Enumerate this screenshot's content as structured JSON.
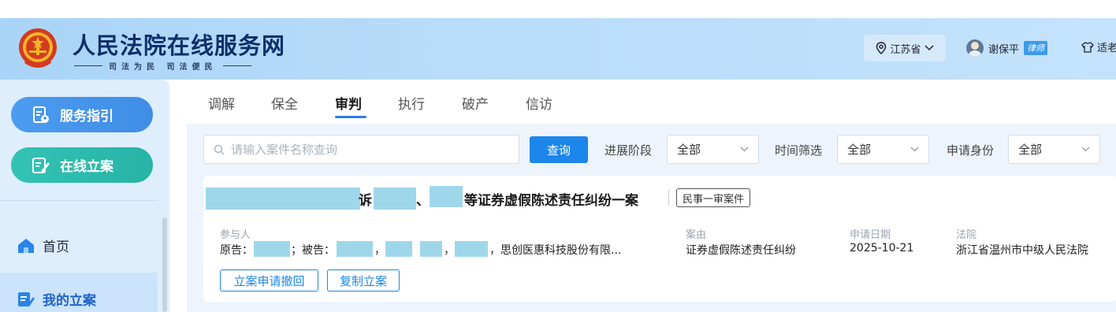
{
  "header": {
    "site_title": "人民法院在线服务网",
    "slogan": "司法为民 司法便民",
    "region": "江苏省",
    "user_name": "谢保平",
    "user_role": "律师",
    "elder_mode": "适老"
  },
  "sidebar": {
    "guide_button": "服务指引",
    "file_button": "在线立案",
    "items": [
      {
        "label": "首页"
      },
      {
        "label": "我的立案"
      }
    ]
  },
  "tabs": [
    {
      "label": "调解"
    },
    {
      "label": "保全"
    },
    {
      "label": "审判",
      "active": true
    },
    {
      "label": "执行"
    },
    {
      "label": "破产"
    },
    {
      "label": "信访"
    }
  ],
  "filters": {
    "search_placeholder": "请输入案件名称查询",
    "query_button": "查询",
    "stage_label": "进展阶段",
    "stage_value": "全部",
    "time_label": "时间筛选",
    "time_value": "全部",
    "identity_label": "申请身份",
    "identity_value": "全部"
  },
  "case": {
    "title_part1": "诉",
    "title_sep": "、",
    "title_part2": "等证券虚假陈述责任纠纷一案",
    "case_type": "民事一审案件",
    "participants_label": "参与人",
    "plaintiff_label": "原告：",
    "semicolon": "；",
    "defendant_label": "被告：",
    "comma": "，",
    "defendant_company": "思创医惠科技股份有限...",
    "cause_label": "案由",
    "cause_value": "证券虚假陈述责任纠纷",
    "date_label": "申请日期",
    "date_value": "2025-10-21",
    "court_label": "法院",
    "court_value": "浙江省温州市中级人民法院",
    "actions": {
      "withdraw": "立案申请撤回",
      "copy": "复制立案"
    }
  },
  "colors": {
    "primary": "#1c86ea",
    "header_bg": "#b8dcf9",
    "sidebar_bg": "#dfeefc",
    "redaction": "#9fd7ea"
  }
}
